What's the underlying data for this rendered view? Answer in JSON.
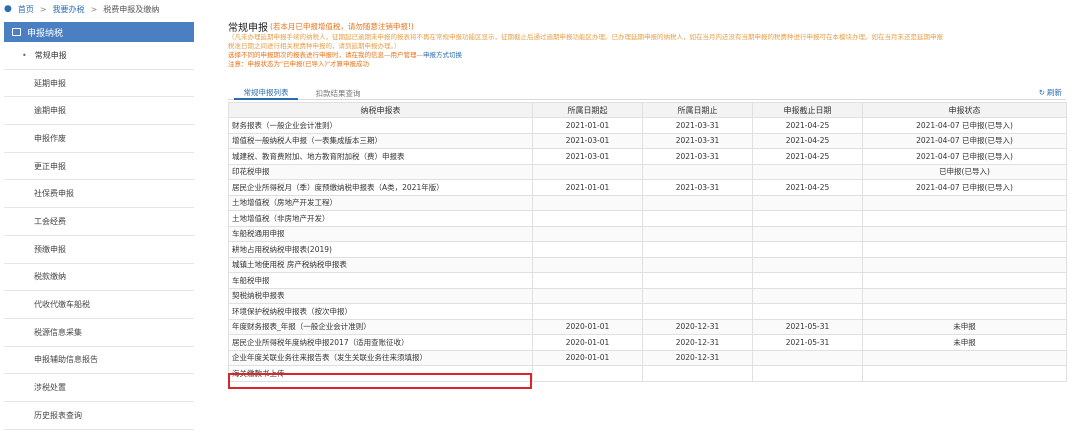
{
  "breadcrumb": {
    "items": [
      "首页",
      "我要办税",
      "税费申报及缴纳"
    ],
    "sep": ">"
  },
  "sidebar": {
    "header": "申报纳税",
    "items": [
      {
        "label": "常规申报",
        "active": true
      },
      {
        "label": "延期申报"
      },
      {
        "label": "逾期申报"
      },
      {
        "label": "申报作废"
      },
      {
        "label": "更正申报"
      },
      {
        "label": "社保费申报"
      },
      {
        "label": "工会经费"
      },
      {
        "label": "预缴申报"
      },
      {
        "label": "税款缴纳"
      },
      {
        "label": "代收代缴车船税"
      },
      {
        "label": "税源信息采集"
      },
      {
        "label": "申报辅助信息报告"
      },
      {
        "label": "涉税处置"
      },
      {
        "label": "历史报表查询"
      }
    ]
  },
  "main": {
    "title": "常规申报",
    "title_warn": "(若本月已申报增值税，请勿随意注销申报!)",
    "note1": "（凡未办理延期申报手续的纳税人，征期起已逾期未申报的报表将不再在常规申报功能区显示，征期截止后通过逾期申报功能区办理。已办理延期申报的纳税人，如在当月内还没有当期申报的税费种进行申报可在本模块办理。如在当月末还是延期申报",
    "note2": "税准日期之间进行相关税费种申报的，请到延期申报办理。）",
    "note3_a": "选择不同的申报期次的报表进行申报时，请在我的信息—用户管理—",
    "note3_b": "申报方式切换",
    "note4": "注意：申报状态为\"已申报(已导入)\"才算申报成功",
    "tabs": [
      "常规申报列表",
      "扣款结果查询"
    ],
    "refresh": "刷新"
  },
  "table": {
    "headers": [
      "纳税申报表",
      "所属日期起",
      "所属日期止",
      "申报截止日期",
      "申报状态"
    ],
    "rows": [
      [
        "财务报表（一般企业会计准则）",
        "2021-01-01",
        "2021-03-31",
        "2021-04-25",
        "2021-04-07 已申报(已导入)"
      ],
      [
        "增值税一般纳税人申报（一表集成版本三期）",
        "2021-03-01",
        "2021-03-31",
        "2021-04-25",
        "2021-04-07 已申报(已导入)"
      ],
      [
        "城建税、教育费附加、地方教育附加税（费）申报表",
        "2021-03-01",
        "2021-03-31",
        "2021-04-25",
        "2021-04-07 已申报(已导入)"
      ],
      [
        "印花税申报",
        "",
        "",
        "",
        "已申报(已导入)"
      ],
      [
        "居民企业所得税月（季）度预缴纳税申报表（A类，2021年版）",
        "2021-01-01",
        "2021-03-31",
        "2021-04-25",
        "2021-04-07 已申报(已导入)"
      ],
      [
        "土地增值税（房地产开发工程）",
        "",
        "",
        "",
        ""
      ],
      [
        "土地增值税（非房地产开发）",
        "",
        "",
        "",
        ""
      ],
      [
        "车船税通用申报",
        "",
        "",
        "",
        ""
      ],
      [
        "耕地占用税纳税申报表(2019)",
        "",
        "",
        "",
        ""
      ],
      [
        "城镇土地使用税 房产税纳税申报表",
        "",
        "",
        "",
        ""
      ],
      [
        "车船税申报",
        "",
        "",
        "",
        ""
      ],
      [
        "契税纳税申报表",
        "",
        "",
        "",
        ""
      ],
      [
        "环境保护税纳税申报表（按次申报）",
        "",
        "",
        "",
        ""
      ],
      [
        "年度财务报表_年报（一般企业会计准则）",
        "2020-01-01",
        "2020-12-31",
        "2021-05-31",
        "未申报"
      ],
      [
        "居民企业所得税年度纳税申报2017（适用查账征收）",
        "2020-01-01",
        "2020-12-31",
        "2021-05-31",
        "未申报"
      ],
      [
        "企业年度关联业务往来报告表（发生关联业务往来须填报）",
        "2020-01-01",
        "2020-12-31",
        "",
        ""
      ],
      [
        "海关缴款书上传",
        "",
        "",
        "",
        ""
      ]
    ]
  },
  "colors": {
    "sidebar_header": "#4a7fc1",
    "accent": "#2b6cb0",
    "highlight_box": "#d9262a",
    "warn": "#e6731a"
  }
}
